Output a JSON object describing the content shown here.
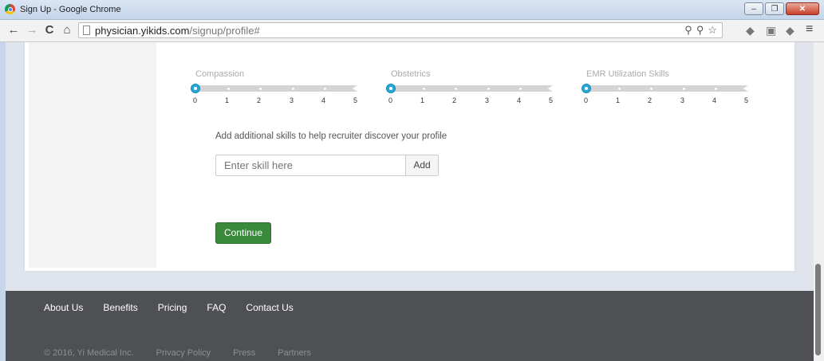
{
  "window": {
    "title": "Sign Up - Google Chrome",
    "controls": [
      "–",
      "❐",
      "✕"
    ]
  },
  "browser": {
    "back_icon": "←",
    "forward_icon": "→",
    "reload_icon": "C",
    "home_icon": "⌂",
    "url_host": "physician.yikids.com",
    "url_path": "/signup/profile#",
    "menu_icon": "≡"
  },
  "skills": [
    {
      "label": "Compassion",
      "value": 0,
      "ticks": [
        "0",
        "1",
        "2",
        "3",
        "4",
        "5"
      ]
    },
    {
      "label": "Obstetrics",
      "value": 0,
      "ticks": [
        "0",
        "1",
        "2",
        "3",
        "4",
        "5"
      ]
    },
    {
      "label": "EMR Utilization Skills",
      "value": 0,
      "ticks": [
        "0",
        "1",
        "2",
        "3",
        "4",
        "5"
      ]
    }
  ],
  "add_skill": {
    "prompt": "Add additional skills to help recruiter discover your profile",
    "placeholder": "Enter skill here",
    "button": "Add"
  },
  "continue_label": "Continue",
  "footer": {
    "links": [
      "About Us",
      "Benefits",
      "Pricing",
      "FAQ",
      "Contact Us"
    ],
    "legal": [
      "© 2016, Yi Medical Inc.",
      "Privacy Policy",
      "Press",
      "Partners"
    ]
  },
  "colors": {
    "accent": "#29a8d8",
    "continue": "#3b8a3c",
    "footer_bg": "#4e5054"
  }
}
